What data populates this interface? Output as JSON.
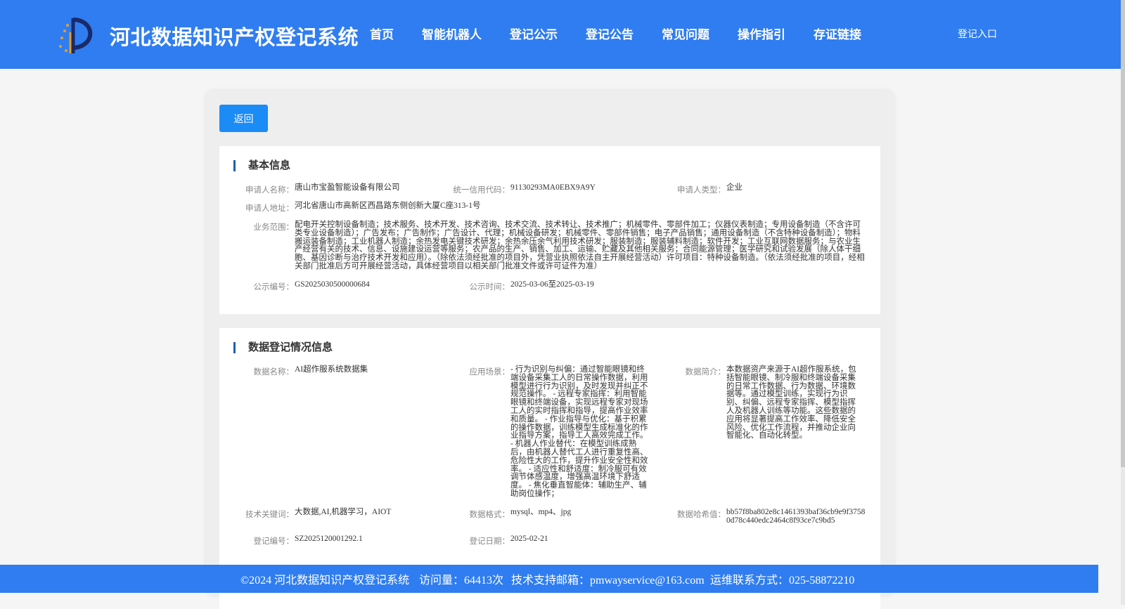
{
  "header": {
    "site_title": "河北数据知识产权登记系统",
    "nav": [
      "首页",
      "智能机器人",
      "登记公示",
      "登记公告",
      "常见问题",
      "操作指引",
      "存证链接"
    ],
    "login_label": "登记入口"
  },
  "back_label": "返回",
  "basic": {
    "title": "基本信息",
    "applicant_name_label": "申请人名称：",
    "applicant_name": "唐山市宝盈智能设备有限公司",
    "credit_code_label": "统一信用代码：",
    "credit_code": "91130293MA0EBX9A9Y",
    "applicant_type_label": "申请人类型：",
    "applicant_type": "企业",
    "address_label": "申请人地址：",
    "address": "河北省唐山市高新区西昌路东侧创新大厦C座313-1号",
    "scope_label": "业务范围：",
    "scope": "配电开关控制设备制造；技术服务、技术开发、技术咨询、技术交流、技术转让、技术推广；机械零件、零部件加工；仪器仪表制造；专用设备制造（不含许可类专业设备制造）；广告发布；广告制作；广告设计、代理；机械设备研发；机械零件、零部件销售；电子产品销售；通用设备制造（不含特种设备制造）；物料搬运装备制造；工业机器人制造；余热发电关键技术研发；余热余压余气利用技术研发；服装制造；服装辅料制造；软件开发；工业互联网数据服务；与农业生产经营有关的技术、信息、设施建设运营等服务；农产品的生产、销售、加工、运输、贮藏及其他相关服务；合同能源管理；医学研究和试验发展（除人体干细胞、基因诊断与治疗技术开发和应用）。（除依法须经批准的项目外，凭营业执照依法自主开展经营活动）许可项目：特种设备制造。（依法须经批准的项目，经相关部门批准后方可开展经营活动，具体经营项目以相关部门批准文件或许可证件为准）",
    "notice_no_label": "公示编号：",
    "notice_no": "GS2025030500000684",
    "notice_time_label": "公示时间：",
    "notice_time": "2025-03-06至2025-03-19"
  },
  "registration": {
    "title": "数据登记情况信息",
    "data_name_label": "数据名称：",
    "data_name": "AI超作服系统数据集",
    "scenario_label": "应用场景：",
    "scenario": "- 行为识别与纠偏：通过智能眼镜和终端设备采集工人的日常操作数据，利用模型进行行为识别，及时发现并纠正不规范操作。 - 远程专家指挥：利用智能眼镜和终端设备，实现远程专家对现场工人的实时指挥和指导，提高作业效率和质量。 - 作业指导与优化：基于积累的操作数据，训练模型生成标准化的作业指导方案，指导工人高效完成工作。 - 机器人作业替代：在模型训练成熟后，由机器人替代工人进行重复性高、危险性大的工作，提升作业安全性和效率。 - 适应性和舒适度：制冷服可有效调节体感温度，增强高温环境下舒适度。 - 焦化垂直智能体：辅助生产、辅助岗位操作；",
    "intro_label": "数据简介：",
    "intro": "本数据资产来源于AI超作服系统，包括智能眼镜、制冷服和终端设备采集的日常工作数据、行为数据、环境数据等。通过模型训练，实现行为识别、纠偏、远程专家指挥、模型指挥人及机器人训练等功能。这些数据的应用将显著提高工作效率、降低安全风险、优化工作流程，并推动企业向智能化、自动化转型。",
    "keywords_label": "技术关键词：",
    "keywords": "大数据,AI,机器学习，AIOT",
    "format_label": "数据格式：",
    "format": "mysql、mp4、jpg",
    "hash_label": "数据哈希值：",
    "hash": "bb57f8ba802e8c1461393baf36cb9e9f37580d78c440edc2464c8f93ce7c9bd5",
    "reg_no_label": "登记编号：",
    "reg_no": "SZ2025120001292.1",
    "reg_date_label": "登记日期：",
    "reg_date": "2025-02-21"
  },
  "footer": {
    "copyright": "©2024 河北数据知识产权登记系统",
    "visits": "访问量：64413次",
    "support": "技术支持邮箱：pmwayservice@163.com",
    "contact": "运维联系方式：025-58872210"
  }
}
